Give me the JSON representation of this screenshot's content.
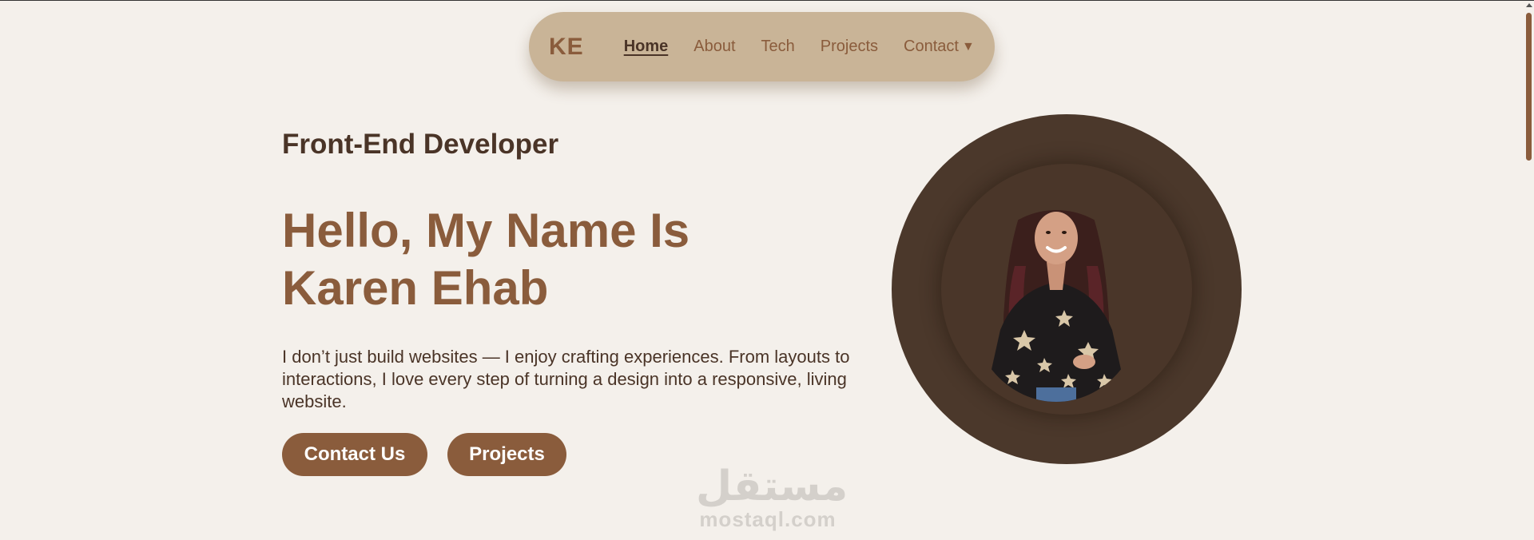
{
  "nav": {
    "brand": "KE",
    "links": [
      {
        "label": "Home",
        "active": true
      },
      {
        "label": "About"
      },
      {
        "label": "Tech"
      },
      {
        "label": "Projects"
      },
      {
        "label": "Contact"
      }
    ],
    "dropdown_icon": "caret-down-icon"
  },
  "hero": {
    "subtitle": "Front-End Developer",
    "headline_line1": "Hello, My Name Is",
    "headline_line2": "Karen Ehab",
    "description": "I don’t just build websites — I enjoy crafting experiences. From layouts to interactions, I love every step of turning a design into a responsive, living website.",
    "buttons": {
      "contact": "Contact Us",
      "projects": "Projects"
    }
  },
  "profile": {
    "photo_subject": "profile-photo"
  },
  "watermark": {
    "arabic": "مستقل",
    "latin": "mostaql.com"
  },
  "colors": {
    "background": "#f4f0eb",
    "navbar": "#c9b497",
    "accent": "#8a5c3c",
    "dark": "#4a3427",
    "circle": "#4b382b"
  }
}
